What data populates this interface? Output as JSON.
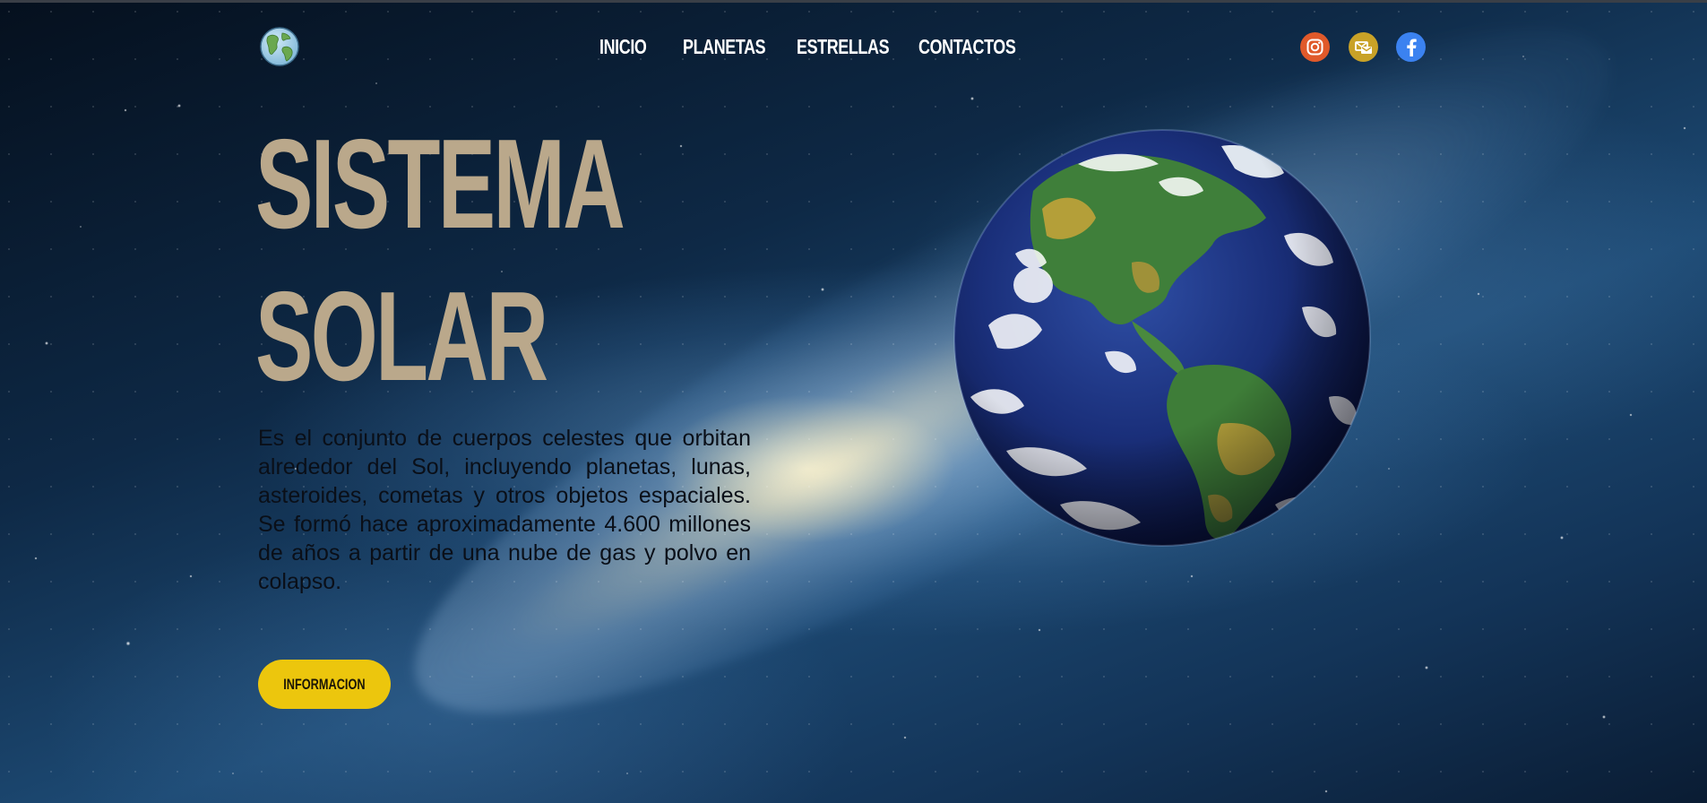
{
  "header": {
    "logo_icon": "earth-globe-icon",
    "nav": [
      {
        "label": "INICIO"
      },
      {
        "label": "PLANETAS"
      },
      {
        "label": "ESTRELLAS"
      },
      {
        "label": "CONTACTOS"
      }
    ],
    "social": [
      {
        "icon": "instagram-icon",
        "color": "#e0592a"
      },
      {
        "icon": "mail-icon",
        "color": "#c9a227"
      },
      {
        "icon": "facebook-icon",
        "color": "#3b82f0"
      }
    ]
  },
  "hero": {
    "title_line1": "SISTEMA",
    "title_line2": "SOLAR",
    "title_color": "#baa88b",
    "description": "Es el conjunto de cuerpos celestes que orbitan alrededor del Sol, incluyendo planetas, lunas, asteroides, cometas y otros objetos espaciales. Se formó hace aproximadamente 4.600 millones de años a partir de una nube de gas y polvo en colapso.",
    "button_label": "INFORMACION",
    "button_color": "#ecc60d",
    "image_icon": "earth-planet-image"
  }
}
